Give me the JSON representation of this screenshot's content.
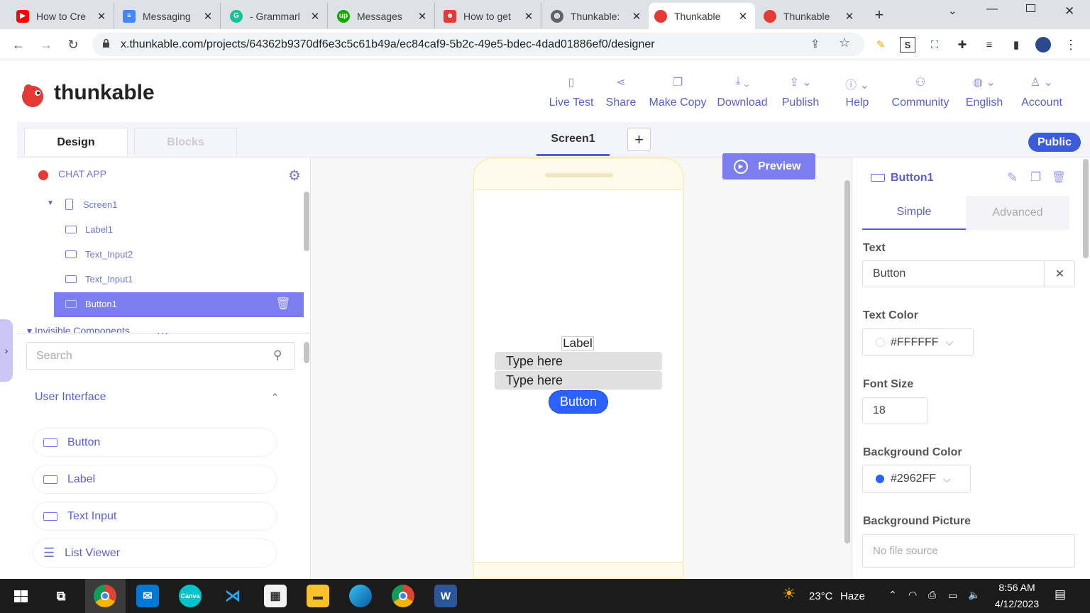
{
  "browser": {
    "tabs": [
      {
        "title": "How to Cre",
        "icon": "youtube-icon",
        "color": "#ff0000"
      },
      {
        "title": "Messaging",
        "icon": "docs-icon",
        "color": "#4285f4"
      },
      {
        "title": "- Grammarl",
        "icon": "grammarly-icon",
        "color": "#15c39a"
      },
      {
        "title": "Messages",
        "icon": "upwork-icon",
        "color": "#14a800"
      },
      {
        "title": "How to get",
        "icon": "robot-icon",
        "color": "#e53935"
      },
      {
        "title": "Thunkable:",
        "icon": "globe-icon",
        "color": "#5f6368"
      },
      {
        "title": "Thunkable",
        "icon": "thunkable-icon",
        "color": "#e53935"
      },
      {
        "title": "Thunkable",
        "icon": "thunkable-icon",
        "color": "#e53935"
      }
    ],
    "url": "x.thunkable.com/projects/64362b9370df6e3c5c61b49a/ec84caf9-5b2c-49e5-bdec-4dad01886ef0/designer"
  },
  "app": {
    "brand": "thunkable",
    "nav": [
      {
        "label": "Live Test",
        "icon": "phone-icon"
      },
      {
        "label": "Share",
        "icon": "share-icon"
      },
      {
        "label": "Make Copy",
        "icon": "copy-icon"
      },
      {
        "label": "Download",
        "icon": "download-icon"
      },
      {
        "label": "Publish",
        "icon": "publish-icon"
      },
      {
        "label": "Help",
        "icon": "info-icon"
      },
      {
        "label": "Community",
        "icon": "community-icon"
      },
      {
        "label": "English",
        "icon": "globe-icon"
      },
      {
        "label": "Account",
        "icon": "user-icon"
      }
    ],
    "tabs": {
      "design": "Design",
      "blocks": "Blocks"
    },
    "screen_tab": "Screen1",
    "public_badge": "Public",
    "preview": "Preview"
  },
  "tree": {
    "project": "CHAT APP",
    "items": [
      "Screen1",
      "Label1",
      "Text_Input2",
      "Text_Input1",
      "Button1"
    ],
    "invisible": "Invisible Components",
    "drag_handle": "···"
  },
  "palette": {
    "search_placeholder": "Search",
    "section": "User Interface",
    "components": [
      "Button",
      "Label",
      "Text Input",
      "List Viewer"
    ]
  },
  "phone": {
    "label": "Label",
    "input1": "Type here",
    "input2": "Type here",
    "button": "Button"
  },
  "props": {
    "component": "Button1",
    "tabs": {
      "simple": "Simple",
      "advanced": "Advanced"
    },
    "text_label": "Text",
    "text_value": "Button",
    "text_color_label": "Text Color",
    "text_color": "#FFFFFF",
    "font_size_label": "Font Size",
    "font_size": "18",
    "bg_color_label": "Background Color",
    "bg_color": "#2962FF",
    "bg_picture_label": "Background Picture",
    "bg_picture_placeholder": "No file source"
  },
  "taskbar": {
    "weather": "23°C",
    "condition": "Haze",
    "time": "8:56 AM",
    "date": "4/12/2023"
  }
}
